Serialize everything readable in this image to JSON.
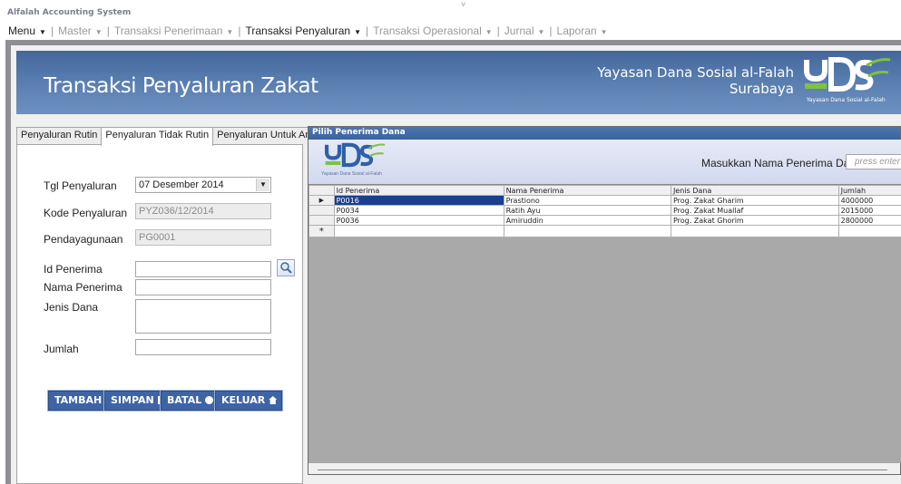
{
  "app_title": "Alfalah Accounting System",
  "menu": [
    {
      "label": "Menu",
      "active": true
    },
    {
      "label": "Master",
      "active": false
    },
    {
      "label": "Transaksi Penerimaan",
      "active": false
    },
    {
      "label": "Transaksi Penyaluran",
      "active": true
    },
    {
      "label": "Transaksi Operasional",
      "active": false
    },
    {
      "label": "Jurnal",
      "active": false
    },
    {
      "label": "Laporan",
      "active": false
    }
  ],
  "banner": {
    "title": "Transaksi Penyaluran Zakat",
    "org_line1": "Yayasan Dana Sosial al-Falah",
    "org_line2": "Surabaya",
    "logo_text": "YDSF",
    "logo_caption": "Yayasan Dana Sosial al-Falah"
  },
  "tabs": [
    {
      "label": "Penyaluran Rutin",
      "selected": false
    },
    {
      "label": "Penyaluran Tidak Rutin",
      "selected": true
    },
    {
      "label": "Penyaluran Untuk Amil",
      "selected": false
    }
  ],
  "form": {
    "tgl_label": "Tgl Penyaluran",
    "tgl_value": "07 Desember 2014",
    "kode_label": "Kode Penyaluran",
    "kode_value": "PYZ036/12/2014",
    "pendaya_label": "Pendayagunaan",
    "pendaya_value": "PG0001",
    "id_label": "Id Penerima",
    "id_value": "",
    "nama_label": "Nama Penerima",
    "nama_value": "",
    "jenis_label": "Jenis Dana",
    "jenis_value": "",
    "jumlah_label": "Jumlah",
    "jumlah_value": ""
  },
  "buttons": {
    "tambah": "TAMBAH",
    "simpan": "SIMPAN",
    "batal": "BATAL",
    "keluar": "KELUAR"
  },
  "dialog": {
    "title": "Pilih Penerima Dana",
    "search_label": "Masukkan Nama Penerima Dana",
    "search_placeholder": "press enter",
    "columns": [
      "Id Penerima",
      "Nama Penerima",
      "Jenis Dana",
      "Jumlah"
    ],
    "rows": [
      {
        "id": "P0016",
        "nama": "Prastiono",
        "jenis": "Prog. Zakat Gharim",
        "jumlah": "4000000",
        "selected": true
      },
      {
        "id": "P0034",
        "nama": "Ratih Ayu",
        "jenis": "Prog. Zakat Muallaf",
        "jumlah": "2015000",
        "selected": false
      },
      {
        "id": "P0036",
        "nama": "Amiruddin",
        "jenis": "Prog. Zakat Ghorim",
        "jumlah": "2800000",
        "selected": false
      }
    ],
    "current_row_marker": "▶",
    "new_row_marker": "*"
  },
  "colors": {
    "banner_blue": "#577cae",
    "button_blue": "#3e64a6",
    "selected_cell": "#1b3f8f"
  }
}
